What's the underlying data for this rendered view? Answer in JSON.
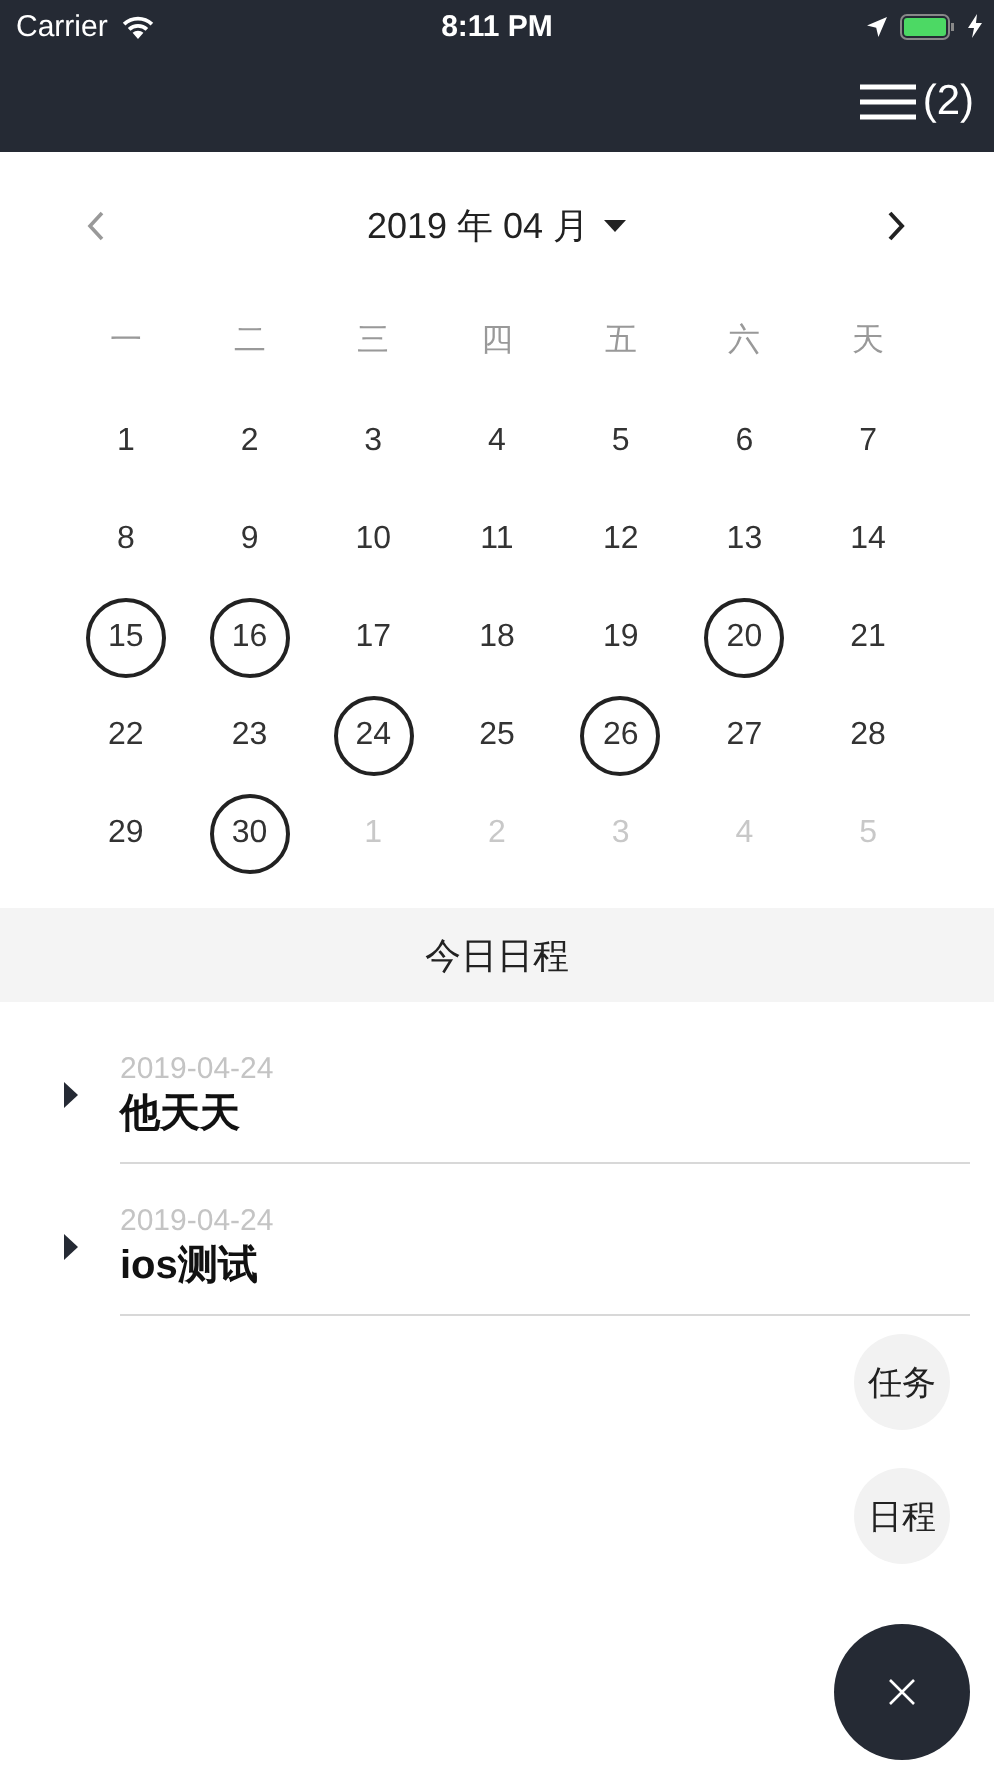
{
  "status_bar": {
    "carrier": "Carrier",
    "time": "8:11 PM"
  },
  "nav_bar": {
    "menu_count": "(2)"
  },
  "calendar": {
    "month_title": "2019 年 04 月",
    "weekdays": [
      "一",
      "二",
      "三",
      "四",
      "五",
      "六",
      "天"
    ],
    "days": [
      {
        "label": "1",
        "in_month": true,
        "has_event": false
      },
      {
        "label": "2",
        "in_month": true,
        "has_event": false
      },
      {
        "label": "3",
        "in_month": true,
        "has_event": false
      },
      {
        "label": "4",
        "in_month": true,
        "has_event": false
      },
      {
        "label": "5",
        "in_month": true,
        "has_event": false
      },
      {
        "label": "6",
        "in_month": true,
        "has_event": false
      },
      {
        "label": "7",
        "in_month": true,
        "has_event": false
      },
      {
        "label": "8",
        "in_month": true,
        "has_event": false
      },
      {
        "label": "9",
        "in_month": true,
        "has_event": false
      },
      {
        "label": "10",
        "in_month": true,
        "has_event": false
      },
      {
        "label": "11",
        "in_month": true,
        "has_event": false
      },
      {
        "label": "12",
        "in_month": true,
        "has_event": false
      },
      {
        "label": "13",
        "in_month": true,
        "has_event": false
      },
      {
        "label": "14",
        "in_month": true,
        "has_event": false
      },
      {
        "label": "15",
        "in_month": true,
        "has_event": true
      },
      {
        "label": "16",
        "in_month": true,
        "has_event": true
      },
      {
        "label": "17",
        "in_month": true,
        "has_event": false
      },
      {
        "label": "18",
        "in_month": true,
        "has_event": false
      },
      {
        "label": "19",
        "in_month": true,
        "has_event": false
      },
      {
        "label": "20",
        "in_month": true,
        "has_event": true
      },
      {
        "label": "21",
        "in_month": true,
        "has_event": false
      },
      {
        "label": "22",
        "in_month": true,
        "has_event": false
      },
      {
        "label": "23",
        "in_month": true,
        "has_event": false
      },
      {
        "label": "24",
        "in_month": true,
        "has_event": true
      },
      {
        "label": "25",
        "in_month": true,
        "has_event": false
      },
      {
        "label": "26",
        "in_month": true,
        "has_event": true
      },
      {
        "label": "27",
        "in_month": true,
        "has_event": false
      },
      {
        "label": "28",
        "in_month": true,
        "has_event": false
      },
      {
        "label": "29",
        "in_month": true,
        "has_event": false
      },
      {
        "label": "30",
        "in_month": true,
        "has_event": true
      },
      {
        "label": "1",
        "in_month": false,
        "has_event": false
      },
      {
        "label": "2",
        "in_month": false,
        "has_event": false
      },
      {
        "label": "3",
        "in_month": false,
        "has_event": false
      },
      {
        "label": "4",
        "in_month": false,
        "has_event": false
      },
      {
        "label": "5",
        "in_month": false,
        "has_event": false
      }
    ]
  },
  "today_section": {
    "title": "今日日程"
  },
  "schedule_items": [
    {
      "date": "2019-04-24",
      "title": "他天天",
      "expanded": false
    },
    {
      "date": "2019-04-24",
      "title": "ios测试",
      "expanded": false
    }
  ],
  "fab_menu": {
    "actions": [
      "任务",
      "日程"
    ],
    "open": true
  }
}
